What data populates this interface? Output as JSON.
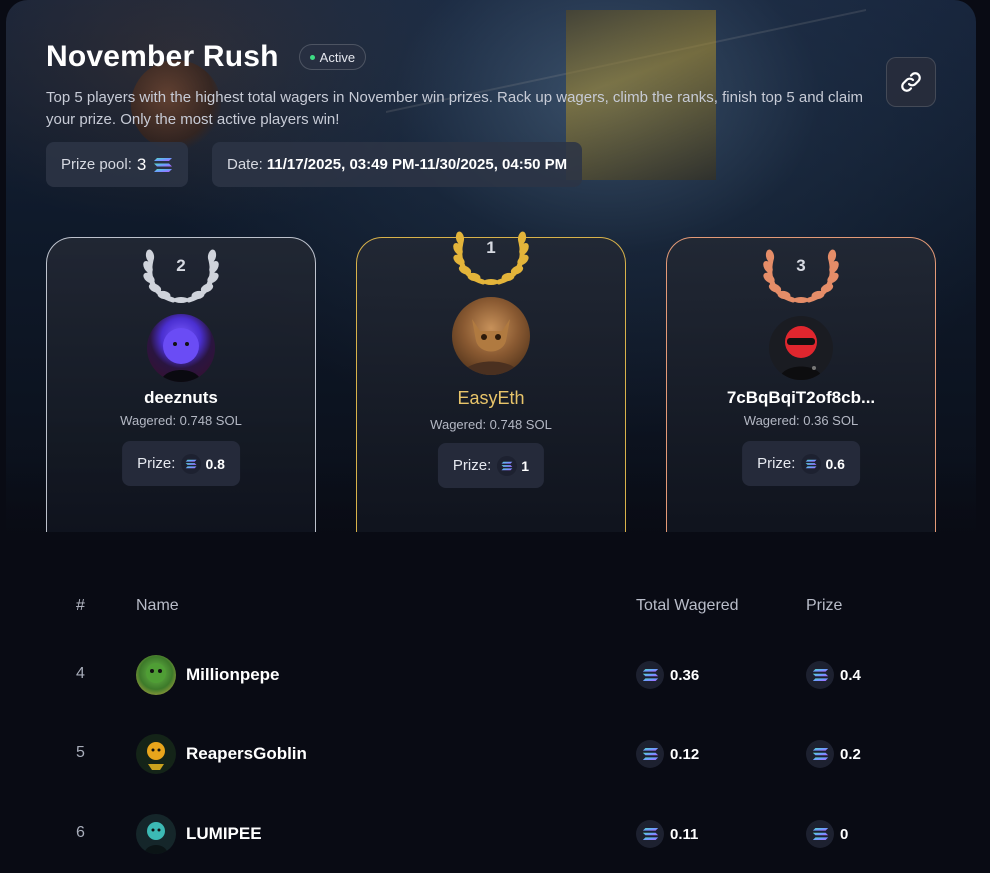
{
  "header": {
    "title": "November Rush",
    "status": "Active",
    "description": "Top 5 players with the highest total wagers in November win prizes. Rack up wagers, climb the ranks, finish top 5 and claim your prize. Only the most active players win!",
    "prize_pool_label": "Prize pool:",
    "prize_pool_value": "3",
    "date_label": "Date:",
    "date_value": "11/17/2025, 03:49 PM-11/30/2025, 04:50 PM"
  },
  "icons": {
    "link": "link-icon",
    "currency": "solana-icon"
  },
  "colors": {
    "gold": "#d8b24a",
    "silver": "#d9dde6",
    "bronze": "#e49a77",
    "active": "#3ddc84"
  },
  "podium": [
    {
      "rank": "2",
      "name": "deeznuts",
      "wagered": "Wagered: 0.748 SOL",
      "prize_label": "Prize:",
      "prize": "0.8"
    },
    {
      "rank": "1",
      "name": "EasyEth",
      "wagered": "Wagered: 0.748 SOL",
      "prize_label": "Prize:",
      "prize": "1"
    },
    {
      "rank": "3",
      "name": "7cBqBqiT2of8cb...",
      "wagered": "Wagered: 0.36 SOL",
      "prize_label": "Prize:",
      "prize": "0.6"
    }
  ],
  "table": {
    "columns": [
      "#",
      "Name",
      "Total Wagered",
      "Prize"
    ],
    "rows": [
      {
        "rank": "4",
        "name": "Millionpepe",
        "wagered": "0.36",
        "prize": "0.4"
      },
      {
        "rank": "5",
        "name": "ReapersGoblin",
        "wagered": "0.12",
        "prize": "0.2"
      },
      {
        "rank": "6",
        "name": "LUMIPEE",
        "wagered": "0.11",
        "prize": "0"
      }
    ]
  }
}
